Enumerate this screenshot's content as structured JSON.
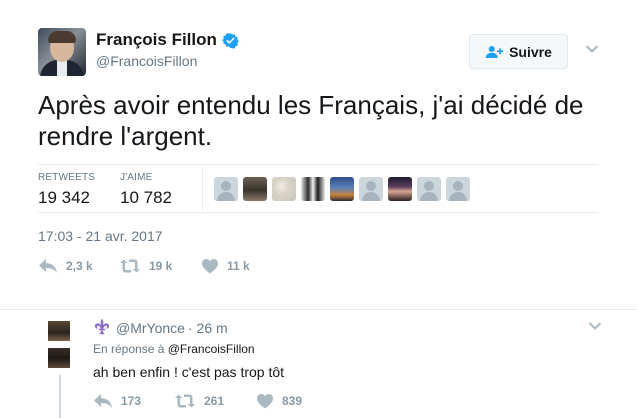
{
  "tweet": {
    "author_name": "François Fillon",
    "author_handle": "@FrancoisFillon",
    "follow_label": "Suivre",
    "text": "Après avoir entendu les Français, j'ai décidé de rendre l'argent.",
    "retweets_label": "RETWEETS",
    "retweets_count": "19 342",
    "likes_label": "J'AIME",
    "likes_count": "10 782",
    "timestamp": "17:03 - 21 avr. 2017",
    "actions": {
      "reply_count": "2,3 k",
      "retweet_count": "19 k",
      "like_count": "11 k"
    },
    "likers": [
      "default",
      "photo-man",
      "photo-drawing",
      "photo-group",
      "photo-blue",
      "default",
      "photo-woman",
      "default",
      "default"
    ]
  },
  "reply": {
    "handle": "@MrYonce",
    "time": "· 26 m",
    "in_reply_prefix": "En réponse à",
    "in_reply_to": "@FrancoisFillon",
    "text": "ah ben enfin ! c'est pas trop tôt",
    "actions": {
      "reply_count": "173",
      "retweet_count": "261",
      "like_count": "839"
    }
  },
  "colors": {
    "accent": "#1da1f2",
    "text_primary": "#14171a",
    "text_secondary": "#657786",
    "icon_gray": "#aab8c2",
    "fleur_purple": "#8e6fc9"
  }
}
